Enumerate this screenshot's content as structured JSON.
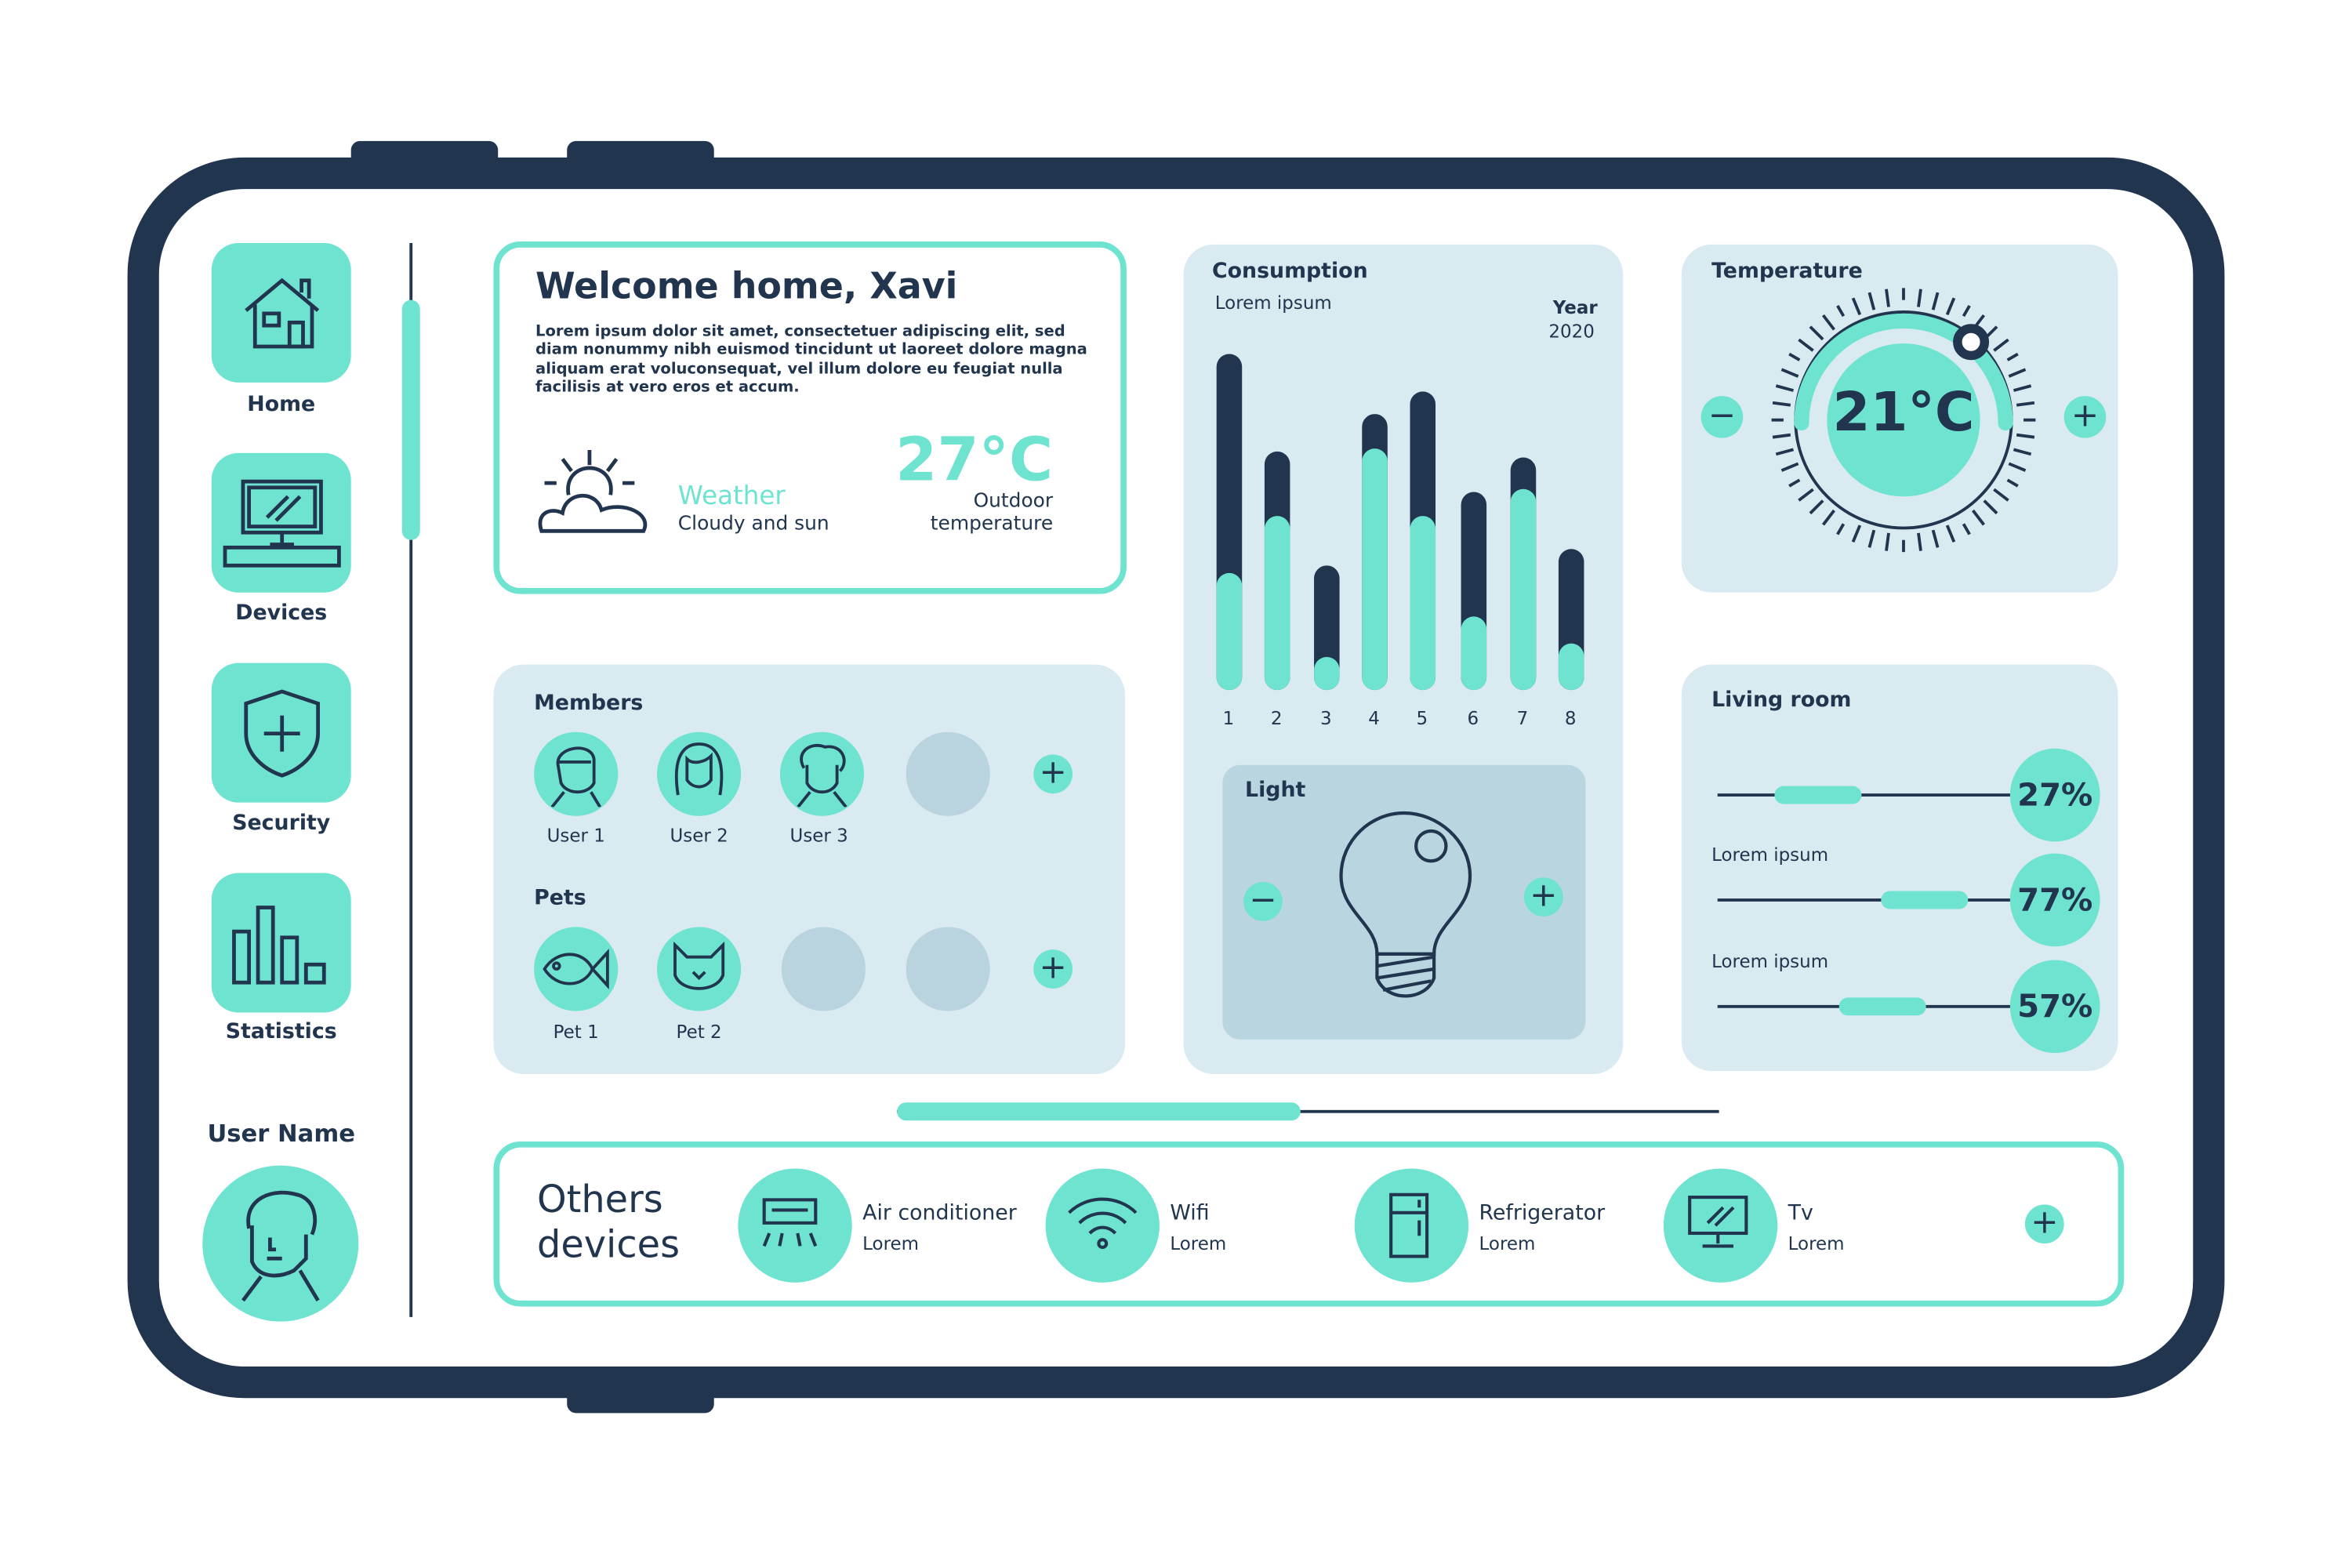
{
  "colors": {
    "dark": "#22354f",
    "accent": "#6de3d0",
    "panel": "#d9eaf0",
    "panel_dark": "#b9d6e0"
  },
  "sidebar": {
    "items": [
      {
        "label": "Home",
        "icon": "house-icon"
      },
      {
        "label": "Devices",
        "icon": "computer-icon"
      },
      {
        "label": "Security",
        "icon": "shield-plus-icon"
      },
      {
        "label": "Statistics",
        "icon": "bar-chart-icon"
      }
    ],
    "user_name": "User Name",
    "vertical_scroll_fraction": 0.2
  },
  "welcome": {
    "title": "Welcome home, Xavi",
    "body": "Lorem ipsum dolor sit amet, consectetuer adipiscing elit, sed diam nonummy nibh euismod tincidunt ut laoreet dolore magna aliquam erat voluconsequat, vel illum dolore eu feugiat nulla facilisis at vero eros et accum.",
    "weather_label": "Weather",
    "weather_desc": "Cloudy and sun",
    "outdoor_temp": "27°C",
    "outdoor_label_1": "Outdoor",
    "outdoor_label_2": "temperature"
  },
  "members": {
    "title": "Members",
    "users": [
      "User 1",
      "User 2",
      "User 3"
    ],
    "pets_title": "Pets",
    "pets": [
      "Pet 1",
      "Pet 2"
    ]
  },
  "consumption": {
    "title": "Consumption",
    "subtitle": "Lorem ipsum",
    "year_label": "Year",
    "year": "2020"
  },
  "chart_data": {
    "type": "bar",
    "title": "Consumption",
    "categories": [
      "1",
      "2",
      "3",
      "4",
      "5",
      "6",
      "7",
      "8"
    ],
    "series": [
      {
        "values": [
          100,
          71,
          37,
          82,
          89,
          59,
          69,
          42
        ]
      },
      {
        "values": [
          35,
          52,
          10,
          72,
          52,
          22,
          60,
          14
        ]
      }
    ],
    "ylim": [
      0,
      100
    ],
    "grid": false
  },
  "light": {
    "title": "Light",
    "minus": "−",
    "plus": "+"
  },
  "temperature": {
    "title": "Temperature",
    "value": "21°C",
    "minus": "−",
    "plus": "+"
  },
  "living_room": {
    "title": "Living room",
    "sliders": [
      {
        "label": "",
        "value": 27,
        "text": "27%"
      },
      {
        "label": "Lorem ipsum",
        "value": 77,
        "text": "77%"
      },
      {
        "label": "Lorem ipsum",
        "value": 57,
        "text": "57%"
      }
    ]
  },
  "horizontal_scroll_fraction": 0.49,
  "others": {
    "title_1": "Others",
    "title_2": "devices",
    "devices": [
      {
        "name": "Air conditioner",
        "sub": "Lorem",
        "icon": "air-conditioner-icon"
      },
      {
        "name": "Wifi",
        "sub": "Lorem",
        "icon": "wifi-icon"
      },
      {
        "name": "Refrigerator",
        "sub": "Lorem",
        "icon": "refrigerator-icon"
      },
      {
        "name": "Tv",
        "sub": "Lorem",
        "icon": "tv-icon"
      }
    ],
    "plus": "+"
  }
}
